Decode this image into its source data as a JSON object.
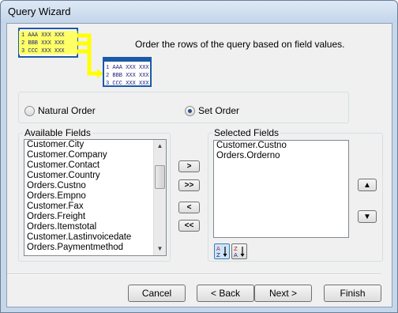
{
  "window": {
    "title": "Query Wizard"
  },
  "banner": {
    "text": "Order the rows of the query based on field values."
  },
  "illustration": {
    "rows_left": [
      {
        "num": "1",
        "code": "AAA",
        "xs": "XXX XXX"
      },
      {
        "num": "2",
        "code": "BBB",
        "xs": "XXX XXX"
      },
      {
        "num": "3",
        "code": "CCC",
        "xs": "XXX XXX"
      }
    ],
    "rows_right": [
      {
        "num": "1",
        "code": "AAA",
        "xs": "XXX XXX"
      },
      {
        "num": "2",
        "code": "BBB",
        "xs": "XXX XXX"
      },
      {
        "num": "3",
        "code": "CCC",
        "xs": "XXX XXX"
      }
    ]
  },
  "order": {
    "natural_label": "Natural Order",
    "set_label": "Set Order",
    "selected": "set"
  },
  "available": {
    "label": "Available Fields",
    "items": [
      "Customer.City",
      "Customer.Company",
      "Customer.Contact",
      "Customer.Country",
      "Orders.Custno",
      "Orders.Empno",
      "Customer.Fax",
      "Orders.Freight",
      "Orders.Itemstotal",
      "Customer.Lastinvoicedate",
      "Orders.Paymentmethod"
    ]
  },
  "selected_fields": {
    "label": "Selected Fields",
    "items": [
      "Customer.Custno",
      "Orders.Orderno"
    ]
  },
  "move_buttons": {
    "add": ">",
    "add_all": ">>",
    "remove": "<",
    "remove_all": "<<"
  },
  "sort_buttons": {
    "ascending": {
      "top": "A",
      "bottom": "Z"
    },
    "descending": {
      "top": "Z",
      "bottom": "A"
    }
  },
  "footer": {
    "cancel": "Cancel",
    "back": "< Back",
    "next": "Next >",
    "finish": "Finish"
  },
  "colors": {
    "accent": "#2b4f82",
    "illustration_yellow": "#ffff00",
    "illustration_blue": "#1a5aa8"
  }
}
